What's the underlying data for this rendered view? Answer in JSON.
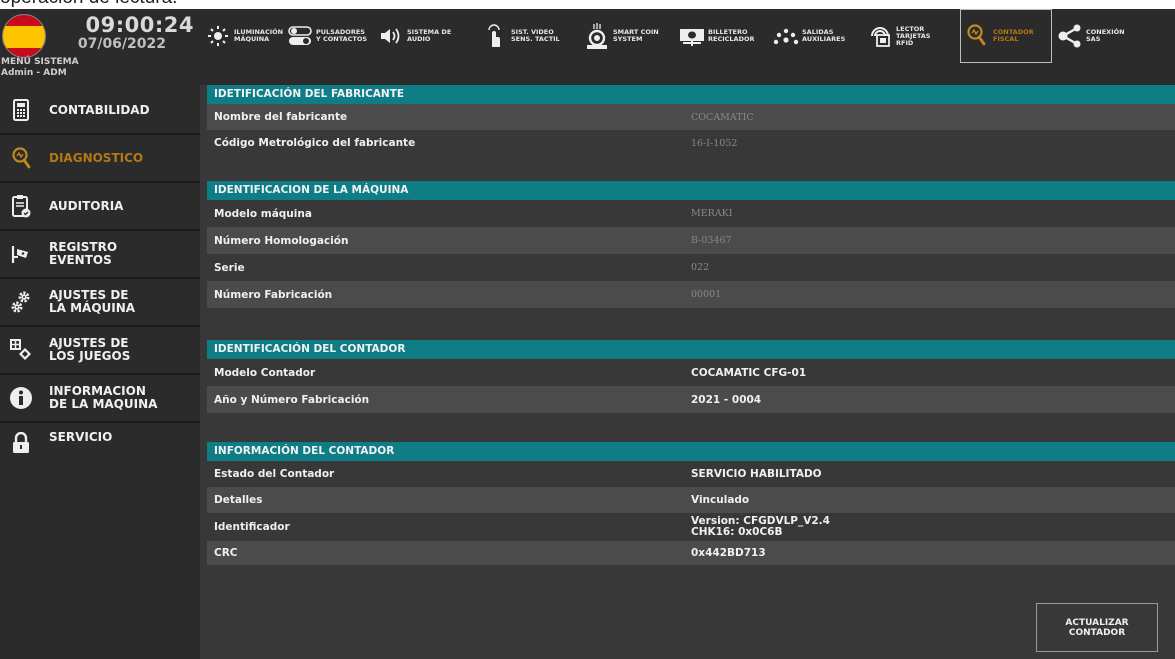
{
  "caption": "operación de lectura.",
  "header": {
    "time": "09:00:24",
    "date": "07/06/2022",
    "menu_title": "MENÚ SISTEMA",
    "user": "Admin - ADM"
  },
  "sidebar": {
    "items": [
      {
        "label": "CONTABILIDAD",
        "icon": "calculator-icon"
      },
      {
        "label": "DIAGNOSTICO",
        "icon": "magnifier-icon",
        "active": true
      },
      {
        "label": "AUDITORIA",
        "icon": "clipboard-check-icon"
      },
      {
        "label": "REGISTRO\nEVENTOS",
        "icon": "camera-icon"
      },
      {
        "label": "AJUSTES DE\nLA MÁQUINA",
        "icon": "gears-icon"
      },
      {
        "label": "AJUSTES DE\nLOS JUEGOS",
        "icon": "grid-diamond-icon"
      },
      {
        "label": "INFORMACION\nDE LA MAQUINA",
        "icon": "info-icon"
      },
      {
        "label": "SERVICIO",
        "icon": "lock-icon"
      }
    ]
  },
  "toolbar": {
    "items": [
      {
        "label": "ILUMINACIÓN\nMÁQUINA",
        "icon": "light-icon"
      },
      {
        "label": "PULSADORES\nY CONTACTOS",
        "icon": "toggle-icon"
      },
      {
        "label": "SISTEMA DE\nAUDIO",
        "icon": "speaker-icon"
      },
      {
        "label": "SIST. VIDEO\nSENS. TACTIL",
        "icon": "touch-icon"
      },
      {
        "label": "SMART COIN\nSYSTEM",
        "icon": "coin-icon"
      },
      {
        "label": "BILLETERO\nRECICLADOR",
        "icon": "banknote-icon"
      },
      {
        "label": "SALIDAS\nAUXILIARES",
        "icon": "dots-arc-icon"
      },
      {
        "label": "LECTOR\nTARJETAS\nRFID",
        "icon": "rfid-icon"
      },
      {
        "label": "CONTADOR\nFISCAL",
        "icon": "magnifier-icon",
        "active": true
      },
      {
        "label": "CONEXIÓN\nSAS",
        "icon": "share-icon"
      }
    ]
  },
  "sections": {
    "fabricante": {
      "title": "IDETIFICACIÓN  DEL FABRICANTE",
      "rows": [
        {
          "label": "Nombre del fabricante",
          "value": "COCAMATIC"
        },
        {
          "label": "Código Metrológico del fabricante",
          "value": "16-I-1052"
        }
      ]
    },
    "maquina": {
      "title": "IDENTIFICACION DE LA MÁQUINA",
      "rows": [
        {
          "label": "Modelo máquina",
          "value": "MERAKI"
        },
        {
          "label": "Número Homologación",
          "value": "B-03467"
        },
        {
          "label": "Serie",
          "value": "022"
        },
        {
          "label": "Número Fabricación",
          "value": "00001"
        }
      ]
    },
    "contador_id": {
      "title": "IDENTIFICACIÓN DEL CONTADOR",
      "rows": [
        {
          "label": "Modelo Contador",
          "value": "COCAMATIC CFG-01"
        },
        {
          "label": "Año y Número Fabricación",
          "value": "2021 - 0004"
        }
      ]
    },
    "contador_info": {
      "title": "INFORMACIÓN DEL CONTADOR",
      "rows": [
        {
          "label": "Estado del Contador",
          "value": "SERVICIO HABILITADO"
        },
        {
          "label": "Detalles",
          "value": "Vinculado"
        },
        {
          "label": "Identificador",
          "value": "Version: CFGDVLP_V2.4\nCHK16: 0x0C6B"
        },
        {
          "label": "CRC",
          "value": "0x442BD713"
        }
      ]
    }
  },
  "update_button": "ACTUALIZAR\nCONTADOR",
  "colors": {
    "accent_teal": "#0e7d86",
    "active_orange": "#b47814",
    "panel_bg": "#2b2b2b",
    "content_bg": "#383838"
  }
}
